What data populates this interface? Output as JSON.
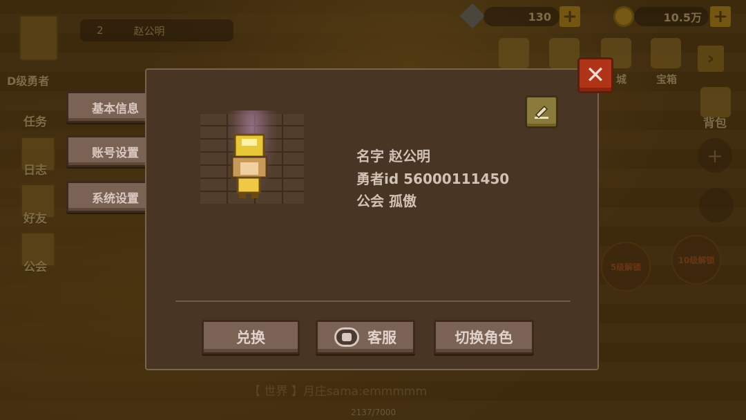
{
  "hud": {
    "gems": "130",
    "gold": "10.5万",
    "player_level": "2",
    "player_name": "赵公明"
  },
  "sidebar": {
    "rank_label": "D级勇者",
    "items": [
      {
        "label": "任务",
        "icon": "scroll-icon"
      },
      {
        "label": "日志",
        "icon": "diary-icon"
      },
      {
        "label": "好友",
        "icon": "friends-icon"
      },
      {
        "label": "公会",
        "icon": "guild-banner-icon"
      }
    ]
  },
  "top_bar": {
    "chest_label": "宝箱",
    "partial_label": "城",
    "bag_label": "背包"
  },
  "locks": {
    "lock5": "5级解锁",
    "lock10": "10级解锁"
  },
  "chat": {
    "line2": "【 世界 】月庄sama:emmmmm"
  },
  "hp": "2137/7000",
  "tabs": [
    {
      "label": "基本信息"
    },
    {
      "label": "账号设置"
    },
    {
      "label": "系统设置"
    }
  ],
  "profile": {
    "name_label": "名字",
    "name_value": "赵公明",
    "id_label": "勇者id",
    "id_value": "56000111450",
    "guild_label": "公会",
    "guild_value": "孤傲"
  },
  "actions": {
    "redeem": "兑换",
    "support": "客服",
    "switch_role": "切换角色"
  },
  "colors": {
    "panel": "#493524",
    "button": "#7a6254",
    "close": "#b03418",
    "edit": "#8a7a3c"
  }
}
